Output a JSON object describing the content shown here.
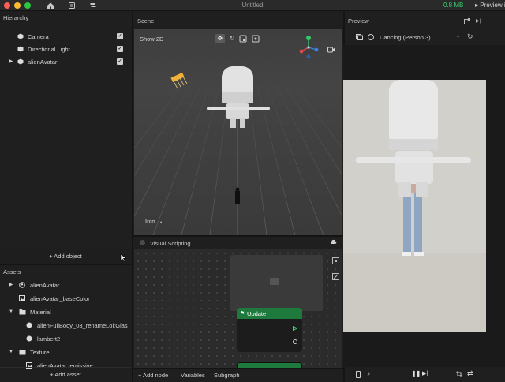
{
  "titlebar": {
    "title": "Untitled",
    "memory": "0.8 MB",
    "preview_label": "Preview in"
  },
  "hierarchy": {
    "title": "Hierarchy",
    "items": [
      {
        "label": "Camera",
        "icon": "cube-icon",
        "expandable": false
      },
      {
        "label": "Directional Light",
        "icon": "cube-icon",
        "expandable": false
      },
      {
        "label": "alienAvatar",
        "icon": "cube-icon",
        "expandable": true
      }
    ],
    "add_label": "+ Add object"
  },
  "assets": {
    "title": "Assets",
    "items": [
      {
        "label": "alienAvatar",
        "icon": "avatar-icon"
      },
      {
        "label": "alienAvatar_baseColor",
        "icon": "image-icon"
      },
      {
        "label": "Material",
        "icon": "folder-icon"
      },
      {
        "label": "alienFullBody_03_renameLol:Glas",
        "icon": "sphere-icon"
      },
      {
        "label": "lambert2",
        "icon": "sphere-icon"
      },
      {
        "label": "Texture",
        "icon": "folder-icon"
      },
      {
        "label": "alienAvatar_emissive",
        "icon": "image-icon"
      }
    ],
    "add_label": "+ Add asset"
  },
  "scene": {
    "title": "Scene",
    "show2d_label": "Show 2D",
    "info_label": "Info",
    "gizmo_axes": {
      "x": "X",
      "y": "Y",
      "z": "Z"
    }
  },
  "visual_scripting": {
    "title": "Visual Scripting",
    "node_title": "Update",
    "bottom_tabs": {
      "add_node": "+ Add node",
      "variables": "Variables",
      "subgraph": "Subgraph"
    }
  },
  "preview": {
    "title": "Preview",
    "effect_name": "Dancing (Person 3)"
  },
  "colors": {
    "accent_green": "#3bd16f",
    "node_header": "#1e7a3c",
    "axis_x": "#e0474c",
    "axis_y": "#38c46b",
    "axis_z": "#3d7fe0"
  }
}
